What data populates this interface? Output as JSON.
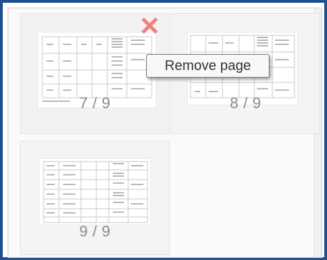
{
  "pages": [
    {
      "label": "7 / 9"
    },
    {
      "label": "8 / 9"
    },
    {
      "label": "9 / 9"
    }
  ],
  "remove_action": {
    "icon": "close-x-icon",
    "tooltip": "Remove page",
    "color": "#f08080"
  },
  "colors": {
    "frame_border": "#1f4f8f",
    "card_bg": "#f4f4f4"
  }
}
